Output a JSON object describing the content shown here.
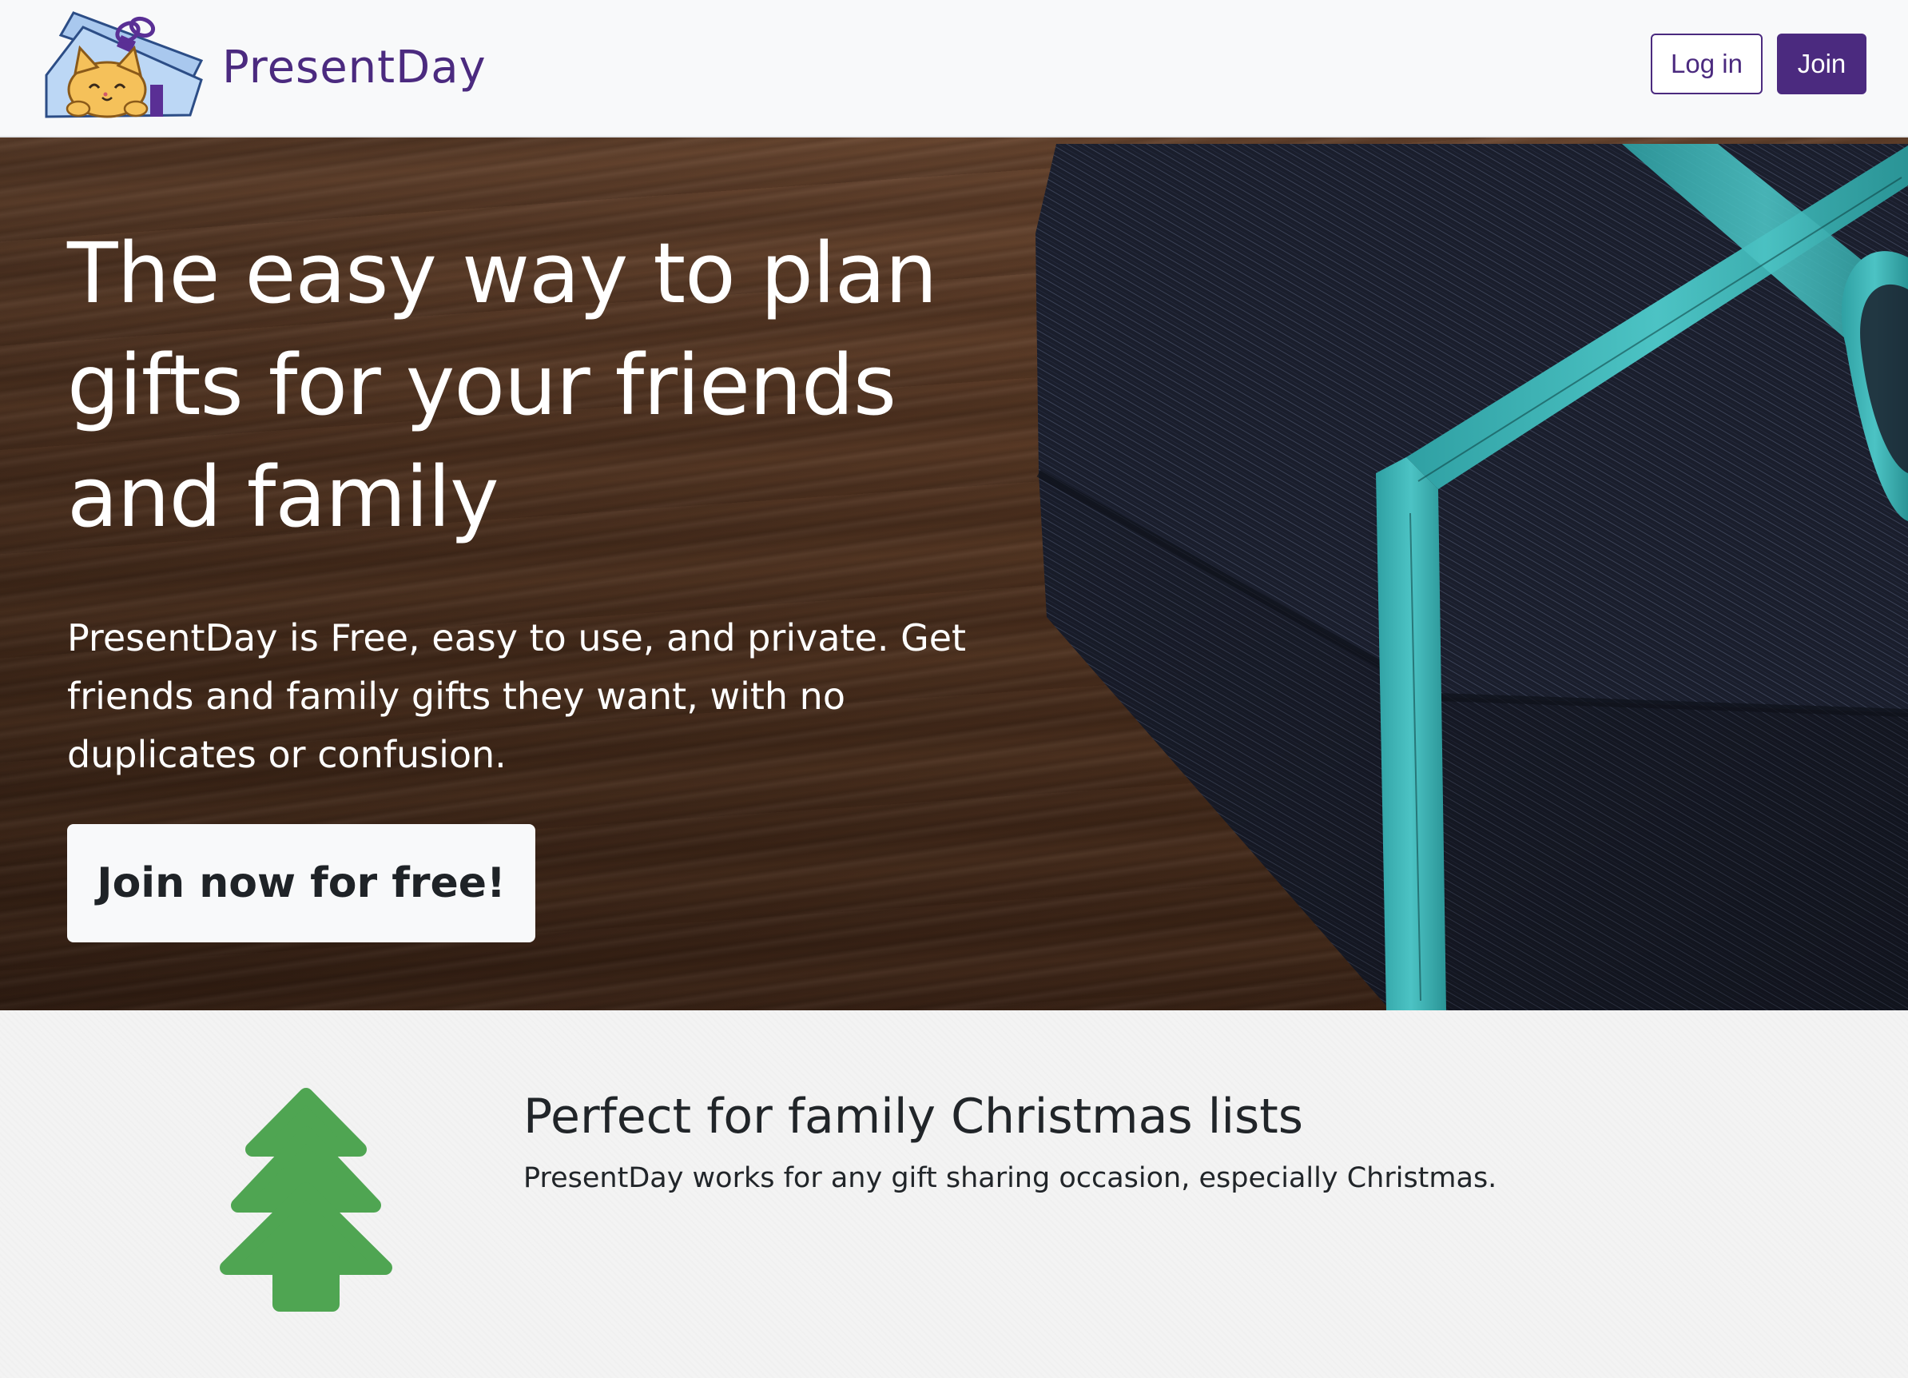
{
  "navbar": {
    "brand_name": "PresentDay",
    "login_label": "Log in",
    "join_label": "Join"
  },
  "hero": {
    "title": "The easy way to plan gifts for your friends and family",
    "lead": "PresentDay is Free, easy to use, and private. Get friends and family gifts they want, with no duplicates or confusion.",
    "cta_label": "Join now for free!"
  },
  "feature": {
    "icon": "christmas-tree-icon",
    "title": "Perfect for family Christmas lists",
    "text": "PresentDay works for any gift sharing occasion, especially Christmas."
  },
  "colors": {
    "brand": "#4b2a7f",
    "tree": "#4fa552",
    "ribbon": "#3fb3b5"
  }
}
